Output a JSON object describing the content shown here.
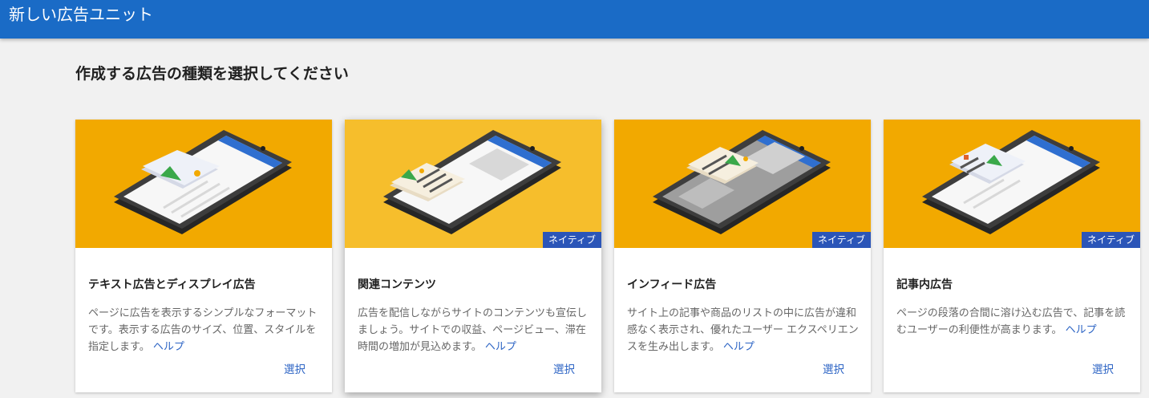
{
  "header": {
    "title": "新しい広告ユニット"
  },
  "main": {
    "heading": "作成する広告の種類を選択してください"
  },
  "cards": [
    {
      "title": "テキスト広告とディスプレイ広告",
      "description": "ページに広告を表示するシンプルなフォーマットです。表示する広告のサイズ、位置、スタイルを指定します。",
      "help": "ヘルプ",
      "select": "選択",
      "badge": "",
      "illustration_bg": "#f2a900"
    },
    {
      "title": "関連コンテンツ",
      "description": "広告を配信しながらサイトのコンテンツも宣伝しましょう。サイトでの収益、ページビュー、滞在時間の増加が見込めます。",
      "help": "ヘルプ",
      "select": "選択",
      "badge": "ネイティブ",
      "illustration_bg": "#f6be2c"
    },
    {
      "title": "インフィード広告",
      "description": "サイト上の記事や商品のリストの中に広告が違和感なく表示され、優れたユーザー エクスペリエンスを生み出します。",
      "help": "ヘルプ",
      "select": "選択",
      "badge": "ネイティブ",
      "illustration_bg": "#f2a900"
    },
    {
      "title": "記事内広告",
      "description": "ページの段落の合間に溶け込む広告で、記事を読むユーザーの利便性が高まります。",
      "help": "ヘルプ",
      "select": "選択",
      "badge": "ネイティブ",
      "illustration_bg": "#f2a900"
    }
  ],
  "colors": {
    "header_bg": "#1a6bc6",
    "page_bg": "#f1f1f1",
    "link": "#2b63c4",
    "badge_bg": "#2b55b8"
  }
}
